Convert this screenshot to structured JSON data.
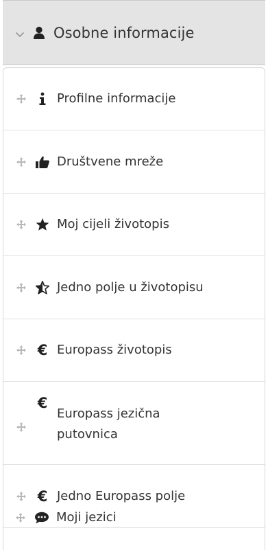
{
  "header": {
    "title": "Osobne informacije",
    "chevron_icon": "chevron-down-icon",
    "user_icon": "user-icon"
  },
  "items": [
    {
      "label": "Profilne informacije",
      "icon": "info-icon"
    },
    {
      "label": "Društvene mreže",
      "icon": "thumbs-up-icon"
    },
    {
      "label": "Moj cijeli životopis",
      "icon": "star-icon"
    },
    {
      "label": "Jedno polje u životopisu",
      "icon": "half-star-icon"
    },
    {
      "label": "Europass životopis",
      "icon": "euro-icon"
    },
    {
      "label": "Europass jezična putovnica",
      "icon": "euro-icon"
    },
    {
      "label": "Jedno Europass polje",
      "icon": "euro-icon"
    },
    {
      "label": "Moji jezici",
      "icon": "speech-bubble-icon"
    }
  ],
  "colors": {
    "header_bg": "#e4e4e4",
    "border": "#d7d7d7",
    "text": "#333333",
    "drag_handle": "#b8b8b8"
  }
}
